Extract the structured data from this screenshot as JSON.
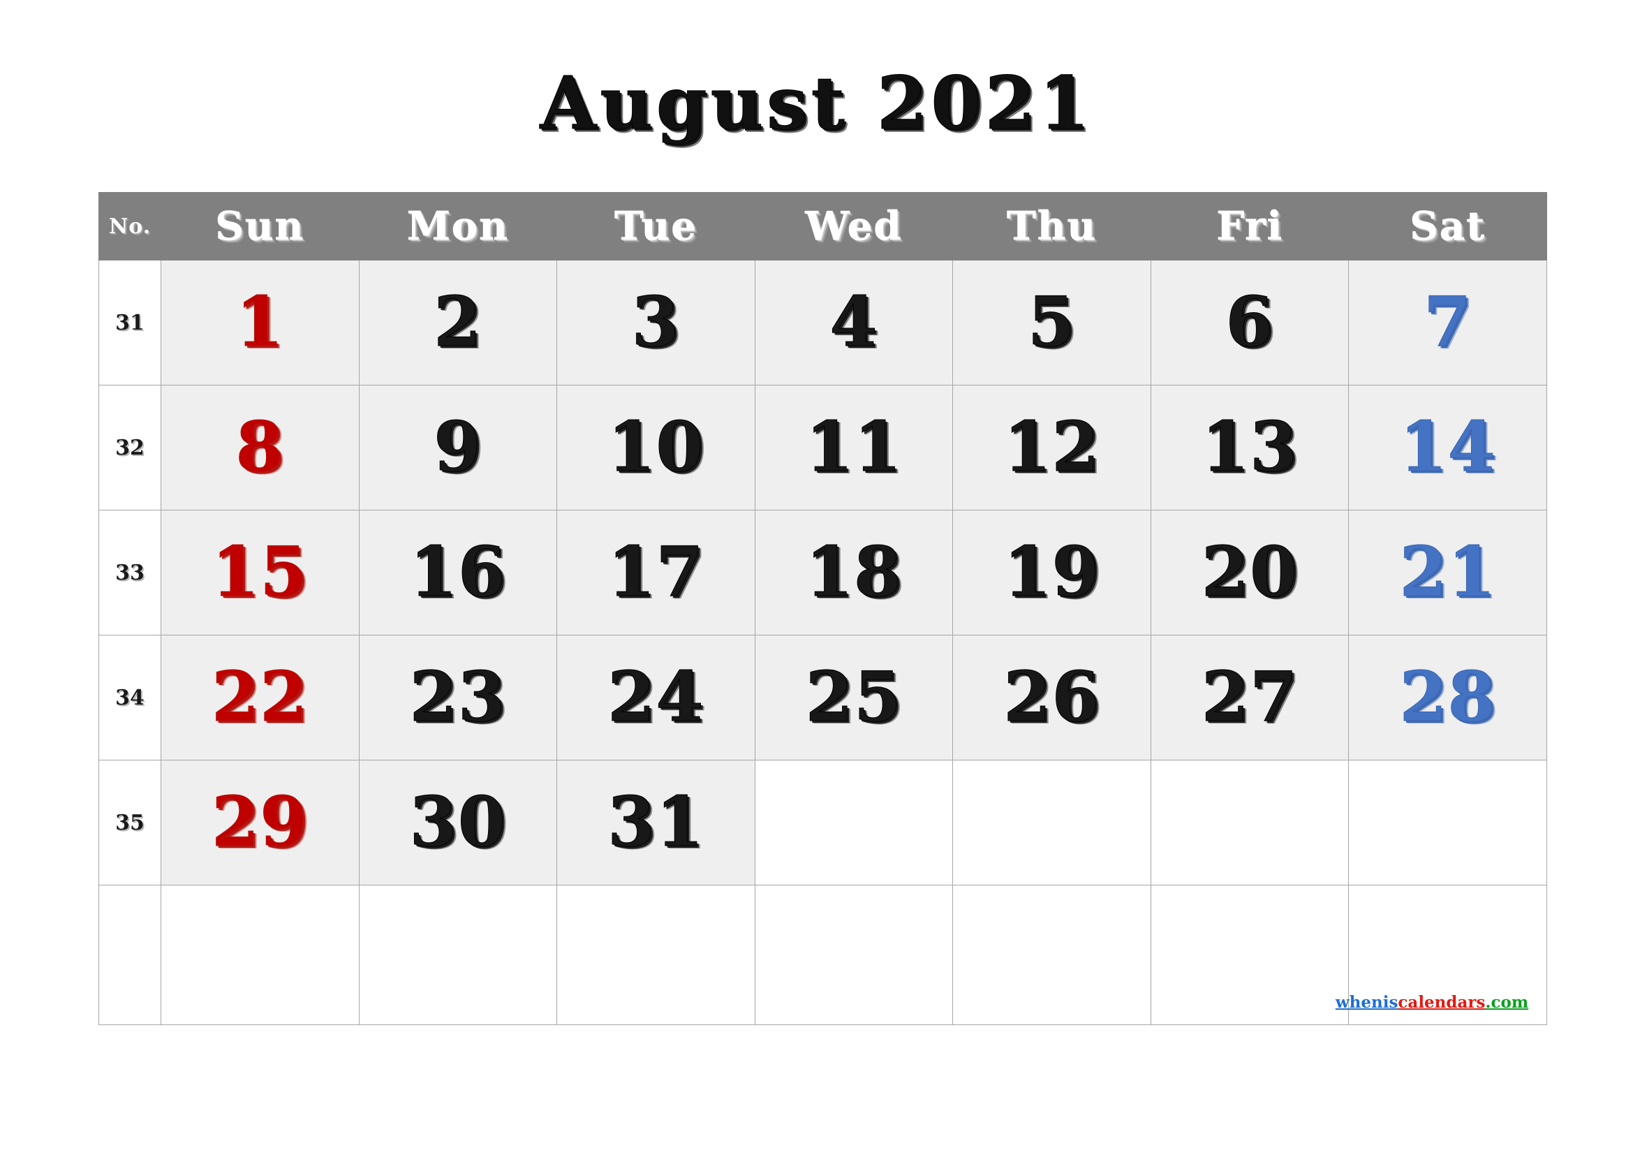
{
  "title": "August 2021",
  "header": {
    "week_no_label": "No.",
    "days": [
      "Sun",
      "Mon",
      "Tue",
      "Wed",
      "Thu",
      "Fri",
      "Sat"
    ]
  },
  "colors": {
    "header_background": "#808080",
    "header_text": "#ffffff",
    "cell_filled": "#efefef",
    "cell_empty": "#ffffff",
    "grid_line": "#a6a6a6",
    "sunday": "#c00000",
    "saturday": "#4573c4",
    "weekday": "#181818"
  },
  "weeks": [
    {
      "week_no": "31",
      "days": [
        {
          "n": "1",
          "kind": "sun",
          "filled": true
        },
        {
          "n": "2",
          "kind": "weekday",
          "filled": true
        },
        {
          "n": "3",
          "kind": "weekday",
          "filled": true
        },
        {
          "n": "4",
          "kind": "weekday",
          "filled": true
        },
        {
          "n": "5",
          "kind": "weekday",
          "filled": true
        },
        {
          "n": "6",
          "kind": "weekday",
          "filled": true
        },
        {
          "n": "7",
          "kind": "sat",
          "filled": true
        }
      ]
    },
    {
      "week_no": "32",
      "days": [
        {
          "n": "8",
          "kind": "sun",
          "filled": true
        },
        {
          "n": "9",
          "kind": "weekday",
          "filled": true
        },
        {
          "n": "10",
          "kind": "weekday",
          "filled": true
        },
        {
          "n": "11",
          "kind": "weekday",
          "filled": true
        },
        {
          "n": "12",
          "kind": "weekday",
          "filled": true
        },
        {
          "n": "13",
          "kind": "weekday",
          "filled": true
        },
        {
          "n": "14",
          "kind": "sat",
          "filled": true
        }
      ]
    },
    {
      "week_no": "33",
      "days": [
        {
          "n": "15",
          "kind": "sun",
          "filled": true
        },
        {
          "n": "16",
          "kind": "weekday",
          "filled": true
        },
        {
          "n": "17",
          "kind": "weekday",
          "filled": true
        },
        {
          "n": "18",
          "kind": "weekday",
          "filled": true
        },
        {
          "n": "19",
          "kind": "weekday",
          "filled": true
        },
        {
          "n": "20",
          "kind": "weekday",
          "filled": true
        },
        {
          "n": "21",
          "kind": "sat",
          "filled": true
        }
      ]
    },
    {
      "week_no": "34",
      "days": [
        {
          "n": "22",
          "kind": "sun",
          "filled": true
        },
        {
          "n": "23",
          "kind": "weekday",
          "filled": true
        },
        {
          "n": "24",
          "kind": "weekday",
          "filled": true
        },
        {
          "n": "25",
          "kind": "weekday",
          "filled": true
        },
        {
          "n": "26",
          "kind": "weekday",
          "filled": true
        },
        {
          "n": "27",
          "kind": "weekday",
          "filled": true
        },
        {
          "n": "28",
          "kind": "sat",
          "filled": true
        }
      ]
    },
    {
      "week_no": "35",
      "days": [
        {
          "n": "29",
          "kind": "sun",
          "filled": true
        },
        {
          "n": "30",
          "kind": "weekday",
          "filled": true
        },
        {
          "n": "31",
          "kind": "weekday",
          "filled": true
        },
        {
          "n": "",
          "kind": "weekday",
          "filled": false
        },
        {
          "n": "",
          "kind": "weekday",
          "filled": false
        },
        {
          "n": "",
          "kind": "weekday",
          "filled": false
        },
        {
          "n": "",
          "kind": "sat",
          "filled": false
        }
      ]
    },
    {
      "week_no": "",
      "days": [
        {
          "n": "",
          "kind": "sun",
          "filled": false
        },
        {
          "n": "",
          "kind": "weekday",
          "filled": false
        },
        {
          "n": "",
          "kind": "weekday",
          "filled": false
        },
        {
          "n": "",
          "kind": "weekday",
          "filled": false
        },
        {
          "n": "",
          "kind": "weekday",
          "filled": false
        },
        {
          "n": "",
          "kind": "weekday",
          "filled": false
        },
        {
          "n": "",
          "kind": "sat",
          "filled": false
        }
      ]
    }
  ],
  "watermark": {
    "part1": "whenis",
    "part2": "calendars",
    "part3": ".com"
  }
}
